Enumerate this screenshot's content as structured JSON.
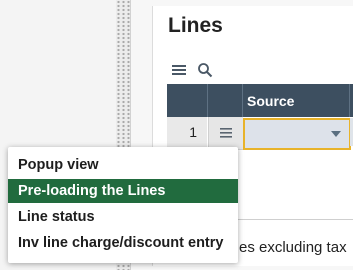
{
  "panel": {
    "title": "Lines"
  },
  "toolbar": {
    "icons": [
      "menu-icon",
      "search-icon"
    ]
  },
  "grid": {
    "columns": [
      "",
      "",
      "Source"
    ],
    "rows": [
      {
        "number": "1",
        "source_value": ""
      }
    ]
  },
  "background_text": "es excluding tax",
  "context_menu": {
    "items": [
      {
        "label": "Popup view",
        "selected": false
      },
      {
        "label": "Pre-loading the Lines",
        "selected": true
      },
      {
        "label": "Line status",
        "selected": false
      },
      {
        "label": "Inv line charge/discount entry",
        "selected": false
      }
    ]
  },
  "colors": {
    "header_bg": "#3d4f60",
    "selected_item_bg": "#216b3e",
    "focus_border": "#e8b32a"
  }
}
